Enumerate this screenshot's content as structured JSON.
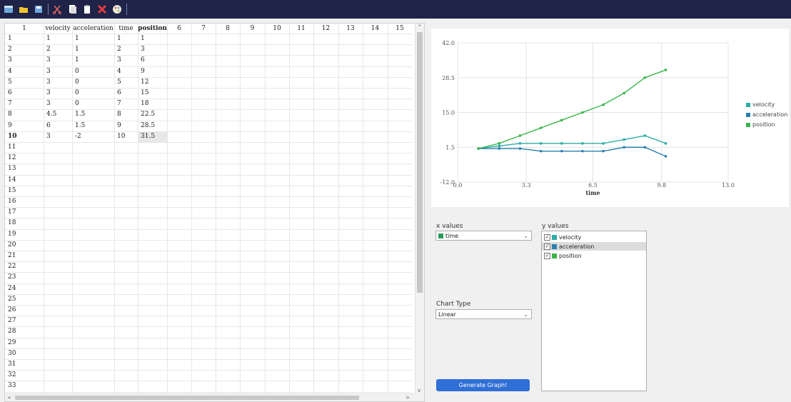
{
  "toolbar": {
    "buttons": [
      "new-icon",
      "open-icon",
      "save-icon",
      "cut-icon",
      "copy-icon",
      "paste-icon",
      "delete-icon",
      "palette-icon"
    ]
  },
  "sheet": {
    "column_headers": [
      "1",
      "velocity",
      "acceleration",
      "time",
      "position",
      "6",
      "7",
      "8",
      "9",
      "10",
      "11",
      "12",
      "13",
      "14",
      "15"
    ],
    "row_count": 34,
    "rows": [
      [
        "1",
        "1",
        "1",
        "1"
      ],
      [
        "2",
        "1",
        "2",
        "3"
      ],
      [
        "3",
        "1",
        "3",
        "6"
      ],
      [
        "3",
        "0",
        "4",
        "9"
      ],
      [
        "3",
        "0",
        "5",
        "12"
      ],
      [
        "3",
        "0",
        "6",
        "15"
      ],
      [
        "3",
        "0",
        "7",
        "18"
      ],
      [
        "4.5",
        "1.5",
        "8",
        "22.5"
      ],
      [
        "6",
        "1.5",
        "9",
        "28.5"
      ],
      [
        "3",
        "-2",
        "10",
        "31.5"
      ]
    ],
    "selected_row": 10
  },
  "chart_data": {
    "type": "line",
    "xlabel": "time",
    "ylabel": "",
    "xlim": [
      0.0,
      13.0
    ],
    "ylim": [
      -12.0,
      42.0
    ],
    "xticks": [
      "0.0",
      "3.3",
      "6.5",
      "9.8",
      "13.0"
    ],
    "yticks": [
      "42.0",
      "28.5",
      "15.0",
      "1.5",
      "-12.0"
    ],
    "x": [
      1,
      2,
      3,
      4,
      5,
      6,
      7,
      8,
      9,
      10
    ],
    "series": [
      {
        "name": "velocity",
        "color": "#2eada5",
        "values": [
          1,
          2,
          3,
          3,
          3,
          3,
          3,
          4.5,
          6,
          3
        ]
      },
      {
        "name": "acceleration",
        "color": "#2a7fae",
        "values": [
          1,
          1,
          1,
          0,
          0,
          0,
          0,
          1.5,
          1.5,
          -2
        ]
      },
      {
        "name": "position",
        "color": "#3ab54a",
        "values": [
          1,
          3,
          6,
          9,
          12,
          15,
          18,
          22.5,
          28.5,
          31.5
        ]
      }
    ],
    "grid": true,
    "legend": "right"
  },
  "controls": {
    "x_values_label": "x values",
    "x_selected": "time",
    "x_color": "#2c9b5e",
    "y_values_label": "y values",
    "y_items": [
      {
        "label": "velocity",
        "color": "#2eada5",
        "checked": true
      },
      {
        "label": "acceleration",
        "color": "#2a7fae",
        "checked": true
      },
      {
        "label": "position",
        "color": "#3ab54a",
        "checked": true
      }
    ],
    "y_highlight_index": 1,
    "chart_type_label": "Chart Type",
    "chart_type_selected": "Linear",
    "generate_button": "Generate Graph!"
  }
}
